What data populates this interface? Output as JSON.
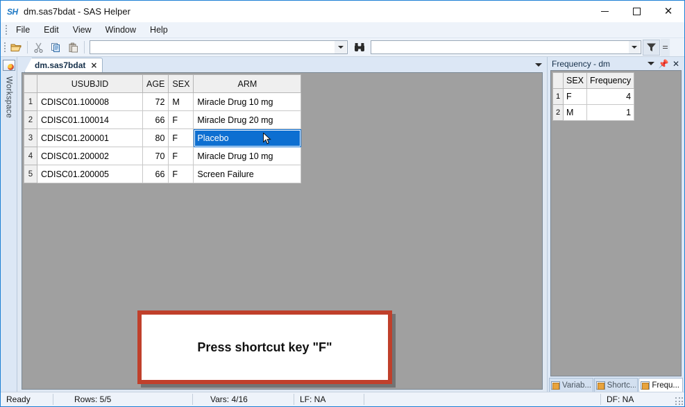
{
  "window": {
    "icon": "sh-logo-icon",
    "title": "dm.sas7bdat - SAS Helper",
    "minimize_label": "Minimize",
    "maximize_label": "Maximize",
    "close_label": "Close"
  },
  "menu": {
    "items": [
      {
        "label": "File"
      },
      {
        "label": "Edit"
      },
      {
        "label": "View"
      },
      {
        "label": "Window"
      },
      {
        "label": "Help"
      }
    ]
  },
  "toolbar": {
    "buttons": [
      {
        "name": "open-icon",
        "label": "Open"
      },
      {
        "name": "cut-icon",
        "label": "Cut"
      },
      {
        "name": "copy-icon",
        "label": "Copy"
      },
      {
        "name": "paste-icon",
        "label": "Paste"
      }
    ],
    "search_combo_value": "",
    "search_combo_placeholder": "",
    "find_label": "Find",
    "filter_combo_value": "",
    "filter_label": "Filter",
    "overflow_label": "More"
  },
  "document_tabs": {
    "tabs": [
      {
        "label": "dm.sas7bdat",
        "close_label": "×",
        "active": true
      }
    ],
    "dropdown_label": "Tab list"
  },
  "workspace": {
    "label": "Workspace"
  },
  "grid": {
    "columns": [
      "USUBJID",
      "AGE",
      "SEX",
      "ARM"
    ],
    "rows": [
      {
        "num": "1",
        "usubjid": "CDISC01.100008",
        "age": "72",
        "sex": "M",
        "arm": "Miracle Drug 10 mg"
      },
      {
        "num": "2",
        "usubjid": "CDISC01.100014",
        "age": "66",
        "sex": "F",
        "arm": "Miracle Drug 20 mg"
      },
      {
        "num": "3",
        "usubjid": "CDISC01.200001",
        "age": "80",
        "sex": "F",
        "arm": "Placebo"
      },
      {
        "num": "4",
        "usubjid": "CDISC01.200002",
        "age": "70",
        "sex": "F",
        "arm": "Miracle Drug 10 mg"
      },
      {
        "num": "5",
        "usubjid": "CDISC01.200005",
        "age": "66",
        "sex": "F",
        "arm": "Screen Failure"
      }
    ],
    "selected_cell": {
      "row": 3,
      "column": "ARM",
      "value": "Placebo"
    },
    "selection_color": "#0d6fd1",
    "background_color": "#a0a0a0"
  },
  "callout": {
    "text": "Press shortcut key \"F\"",
    "border_color": "#c0402b",
    "background_color": "#ffffff"
  },
  "dock": {
    "title": "Frequency - dm",
    "dropdown_label": "Panel menu",
    "pin_label": "Auto Hide",
    "close_label": "Close",
    "table": {
      "columns": [
        "SEX",
        "Frequency"
      ],
      "rows": [
        {
          "num": "1",
          "sex": "F",
          "frequency": "4"
        },
        {
          "num": "2",
          "sex": "M",
          "frequency": "1"
        }
      ]
    },
    "tabs": [
      {
        "label": "Variab...",
        "active": false
      },
      {
        "label": "Shortc...",
        "active": false
      },
      {
        "label": "Frequ...",
        "active": true
      }
    ]
  },
  "statusbar": {
    "status": "Ready",
    "rows": "Rows: 5/5",
    "vars": "Vars: 4/16",
    "lf": "LF: NA",
    "df": "DF: NA"
  }
}
